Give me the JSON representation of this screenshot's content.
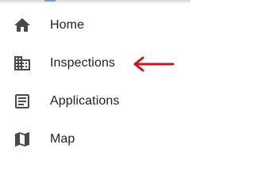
{
  "nav": {
    "items": [
      {
        "label": "Home",
        "icon": "home-icon"
      },
      {
        "label": "Inspections",
        "icon": "building-icon"
      },
      {
        "label": "Applications",
        "icon": "form-icon"
      },
      {
        "label": "Map",
        "icon": "map-icon"
      }
    ]
  },
  "colors": {
    "icon": "#4a4a4a",
    "text": "#212121",
    "annotation_arrow": "#d0141b"
  }
}
